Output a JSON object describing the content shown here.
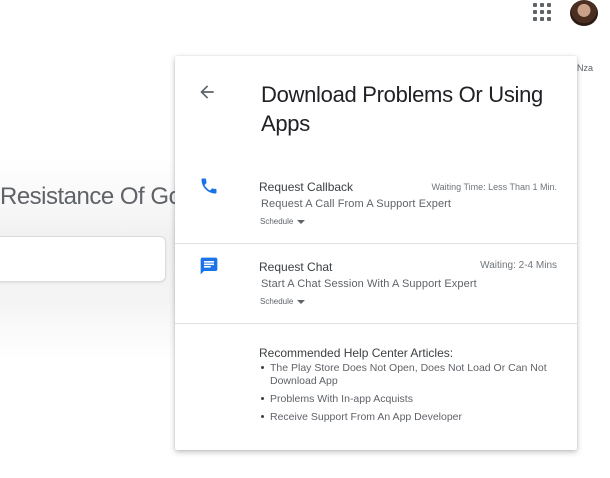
{
  "header": {
    "user_label": "Nza"
  },
  "background_page": {
    "title": "Resistance Of Go"
  },
  "dialog": {
    "title": "Download Problems Or Using Apps",
    "callback": {
      "label": "Request Callback",
      "meta": "Waiting Time: Less Than 1 Min.",
      "description": "Request A Call From A Support Expert",
      "schedule_label": "Schedule"
    },
    "chat": {
      "label": "Request Chat",
      "meta": "Waiting: 2-4 Mins",
      "description": "Start A Chat Session With A Support Expert",
      "schedule_label": "Schedule"
    },
    "help": {
      "heading": "Recommended Help Center Articles:",
      "articles": [
        "The Play Store Does Not Open, Does Not Load Or Can Not Download App",
        "Problems With In-app Acquists",
        "Receive Support From An App Developer"
      ]
    }
  },
  "colors": {
    "accent": "#1a73e8",
    "text": "#3c4043",
    "muted": "#5f6368"
  }
}
